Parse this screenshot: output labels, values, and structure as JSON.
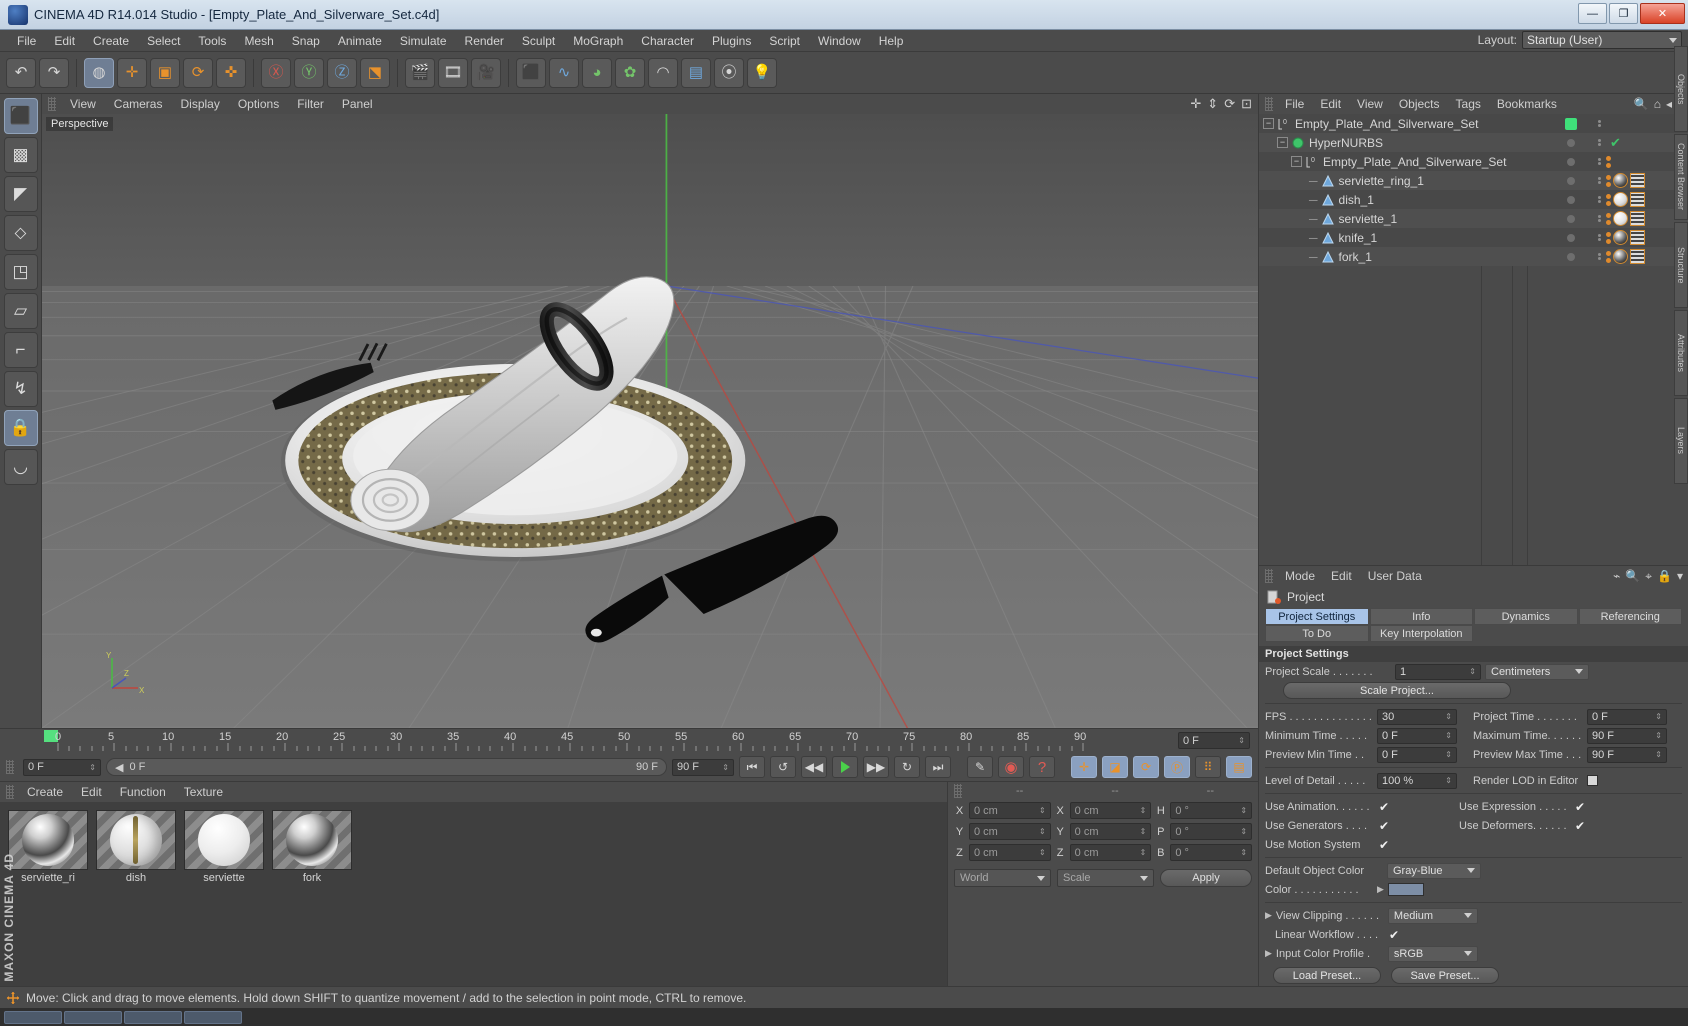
{
  "window": {
    "title": "CINEMA 4D R14.014 Studio - [Empty_Plate_And_Silverware_Set.c4d]",
    "minimize": "—",
    "maximize": "❐",
    "close": "✕"
  },
  "menubar": {
    "items": [
      "File",
      "Edit",
      "Create",
      "Select",
      "Tools",
      "Mesh",
      "Snap",
      "Animate",
      "Simulate",
      "Render",
      "Sculpt",
      "MoGraph",
      "Character",
      "Plugins",
      "Script",
      "Window",
      "Help"
    ],
    "layout_label": "Layout:",
    "layout_value": "Startup (User)"
  },
  "toolbar": {
    "buttons": [
      {
        "name": "undo-button",
        "glyph": "↶"
      },
      {
        "name": "redo-button",
        "glyph": "↷"
      },
      {
        "name": "live-selection-button",
        "glyph": "◍"
      },
      {
        "name": "move-button",
        "glyph": "✛"
      },
      {
        "name": "scale-button",
        "glyph": "▣"
      },
      {
        "name": "rotate-button",
        "glyph": "⟳"
      },
      {
        "name": "axis-move-button",
        "glyph": "✜"
      },
      {
        "name": "x-axis-lock-button",
        "glyph": "Ⓧ"
      },
      {
        "name": "y-axis-lock-button",
        "glyph": "Ⓨ"
      },
      {
        "name": "z-axis-lock-button",
        "glyph": "Ⓩ"
      },
      {
        "name": "world-object-coord-button",
        "glyph": "⬔"
      },
      {
        "name": "render-view-button",
        "glyph": "▶"
      },
      {
        "name": "render-region-button",
        "glyph": "▶"
      },
      {
        "name": "render-settings-button",
        "glyph": "▦"
      },
      {
        "name": "add-cube-button",
        "glyph": "⬛"
      },
      {
        "name": "add-spline-button",
        "glyph": "∿"
      },
      {
        "name": "add-nurbs-button",
        "glyph": "◕"
      },
      {
        "name": "add-array-button",
        "glyph": "✿"
      },
      {
        "name": "add-deformer-button",
        "glyph": "◠"
      },
      {
        "name": "add-scene-button",
        "glyph": "▤"
      },
      {
        "name": "add-camera-button",
        "glyph": "⦿"
      },
      {
        "name": "add-light-button",
        "glyph": "💡"
      }
    ]
  },
  "viewport": {
    "menu": [
      "View",
      "Cameras",
      "Display",
      "Options",
      "Filter",
      "Panel"
    ],
    "label": "Perspective",
    "nav_icons": [
      "move-view-icon",
      "dolly-view-icon",
      "rotate-view-icon",
      "maximize-view-icon",
      "layout-view-icon"
    ],
    "axis": {
      "x": "X",
      "y": "Y",
      "z": "Z"
    }
  },
  "timeline": {
    "ticks": [
      "0",
      "5",
      "10",
      "15",
      "20",
      "25",
      "30",
      "35",
      "40",
      "45",
      "50",
      "55",
      "60",
      "65",
      "70",
      "75",
      "80",
      "85",
      "90"
    ],
    "current_frame_right": "0 F",
    "current_frame": "0 F",
    "bar_value": "0 F",
    "range_end_label": "90 F",
    "range_end_field": "90 F",
    "transport": [
      {
        "name": "goto-start-button",
        "glyph": "⏮"
      },
      {
        "name": "play-back-button",
        "glyph": "↺"
      },
      {
        "name": "step-back-button",
        "glyph": "◀◀"
      },
      {
        "name": "play-button",
        "glyph": "▶"
      },
      {
        "name": "step-forward-button",
        "glyph": "▶▶"
      },
      {
        "name": "play-forward-button",
        "glyph": "↻"
      },
      {
        "name": "goto-end-button",
        "glyph": "⏭"
      }
    ],
    "record_tools": [
      {
        "name": "autokeying-button",
        "glyph": "✎"
      },
      {
        "name": "record-active-objects-button",
        "glyph": "◉"
      },
      {
        "name": "keyframe-selection-button",
        "glyph": "?"
      }
    ],
    "param_toggles": [
      {
        "name": "position-key-button",
        "glyph": "✛"
      },
      {
        "name": "scale-key-button",
        "glyph": "◪"
      },
      {
        "name": "rotation-key-button",
        "glyph": "⟳"
      },
      {
        "name": "pla-key-button",
        "glyph": "Ⓟ"
      },
      {
        "name": "point-level-animation-button",
        "glyph": "⠿"
      },
      {
        "name": "animation-mode-button",
        "glyph": "▤"
      }
    ]
  },
  "material_manager": {
    "menu": [
      "Create",
      "Edit",
      "Function",
      "Texture"
    ],
    "materials": [
      {
        "name": "serviette_ri",
        "style": "chrome"
      },
      {
        "name": "dish",
        "style": "dish"
      },
      {
        "name": "serviette",
        "style": "white"
      },
      {
        "name": "fork",
        "style": "chrome"
      }
    ]
  },
  "coordinates": {
    "headers": [
      "--",
      "--",
      "--"
    ],
    "rows": [
      {
        "axis": "X",
        "position": "0 cm",
        "axis2": "X",
        "size": "0 cm",
        "axis3": "H",
        "rotation": "0 °"
      },
      {
        "axis": "Y",
        "position": "0 cm",
        "axis2": "Y",
        "size": "0 cm",
        "axis3": "P",
        "rotation": "0 °"
      },
      {
        "axis": "Z",
        "position": "0 cm",
        "axis2": "Z",
        "size": "0 cm",
        "axis3": "B",
        "rotation": "0 °"
      }
    ],
    "coord_system": "World",
    "size_mode": "Scale",
    "apply_label": "Apply"
  },
  "object_manager": {
    "menu": [
      "File",
      "Edit",
      "View",
      "Objects",
      "Tags",
      "Bookmarks"
    ],
    "icons": [
      "search-icon",
      "home-icon",
      "collapse-icon",
      "expand-icon"
    ],
    "tree": [
      {
        "name": "Empty_Plate_And_Silverware_Set",
        "indent": 0,
        "icon": "null-object-icon",
        "expander": "-",
        "dot": "green-box",
        "tag": "none"
      },
      {
        "name": "HyperNURBS",
        "indent": 1,
        "icon": "hypernurbs-icon",
        "expander": "-",
        "dot": "gray",
        "tag": "check"
      },
      {
        "name": "Empty_Plate_And_Silverware_Set",
        "indent": 2,
        "icon": "null-object-icon",
        "expander": "-",
        "dot": "gray",
        "tag": "dots"
      },
      {
        "name": "serviette_ring_1",
        "indent": 3,
        "icon": "polygon-object-icon",
        "expander": "",
        "dot": "gray",
        "tag": "material"
      },
      {
        "name": "dish_1",
        "indent": 3,
        "icon": "polygon-object-icon",
        "expander": "",
        "dot": "gray",
        "tag": "material"
      },
      {
        "name": "serviette_1",
        "indent": 3,
        "icon": "polygon-object-icon",
        "expander": "",
        "dot": "gray",
        "tag": "material"
      },
      {
        "name": "knife_1",
        "indent": 3,
        "icon": "polygon-object-icon",
        "expander": "",
        "dot": "gray",
        "tag": "material"
      },
      {
        "name": "fork_1",
        "indent": 3,
        "icon": "polygon-object-icon",
        "expander": "",
        "dot": "gray",
        "tag": "material"
      }
    ]
  },
  "attributes": {
    "menu": [
      "Mode",
      "Edit",
      "User Data"
    ],
    "object_name": "Project",
    "tabs_row1": [
      "Project Settings",
      "Info",
      "Dynamics",
      "Referencing"
    ],
    "tabs_row2": [
      "To Do",
      "Key Interpolation"
    ],
    "active_tab": "Project Settings",
    "section_title": "Project Settings",
    "fields": {
      "project_scale_label": "Project Scale . . . . . . .",
      "project_scale_value": "1",
      "project_scale_unit": "Centimeters",
      "scale_project_button": "Scale Project...",
      "fps_label": "FPS . . . . . . . . . . . . . .",
      "fps_value": "30",
      "project_time_label": "Project Time . . . . . . .",
      "project_time_value": "0 F",
      "minimum_time_label": "Minimum Time . . . . .",
      "minimum_time_value": "0 F",
      "maximum_time_label": "Maximum Time. . . . . .",
      "maximum_time_value": "90 F",
      "preview_min_label": "Preview Min Time  . .",
      "preview_min_value": "0 F",
      "preview_max_label": "Preview Max Time . . .",
      "preview_max_value": "90 F",
      "lod_label": "Level of Detail . . . . .",
      "lod_value": "100 %",
      "render_lod_label": "Render LOD in Editor",
      "render_lod_checked": false,
      "use_animation_label": "Use Animation. . . . . .",
      "use_animation_checked": true,
      "use_expression_label": "Use Expression . . . . .",
      "use_expression_checked": true,
      "use_generators_label": "Use Generators . . . .",
      "use_generators_checked": true,
      "use_deformers_label": "Use Deformers. . . . . .",
      "use_deformers_checked": true,
      "use_motion_label": "Use Motion System",
      "use_motion_checked": true,
      "default_color_label": "Default Object Color",
      "default_color_value": "Gray-Blue",
      "color_label": "Color . . . . . . . . . . .",
      "color_swatch": "#7d8ea6",
      "view_clipping_label": "View Clipping . . . . . .",
      "view_clipping_value": "Medium",
      "linear_workflow_label": "Linear Workflow . . . .",
      "linear_workflow_checked": true,
      "input_profile_label": "Input Color Profile  .",
      "input_profile_value": "sRGB",
      "load_preset_button": "Load Preset...",
      "save_preset_button": "Save Preset..."
    }
  },
  "right_tabs": [
    "Objects",
    "Content Browser",
    "Structure",
    "Attributes",
    "Layers"
  ],
  "statusbar": {
    "text": "Move: Click and drag to move elements. Hold down SHIFT to quantize movement / add to the selection in point mode, CTRL to remove."
  },
  "brand": "MAXON CINEMA 4D",
  "colors": {
    "accent_blue": "#a8c4e8",
    "orange": "#e08a2c",
    "green": "#3fe07a",
    "panel_bg": "#4b4b4b"
  }
}
